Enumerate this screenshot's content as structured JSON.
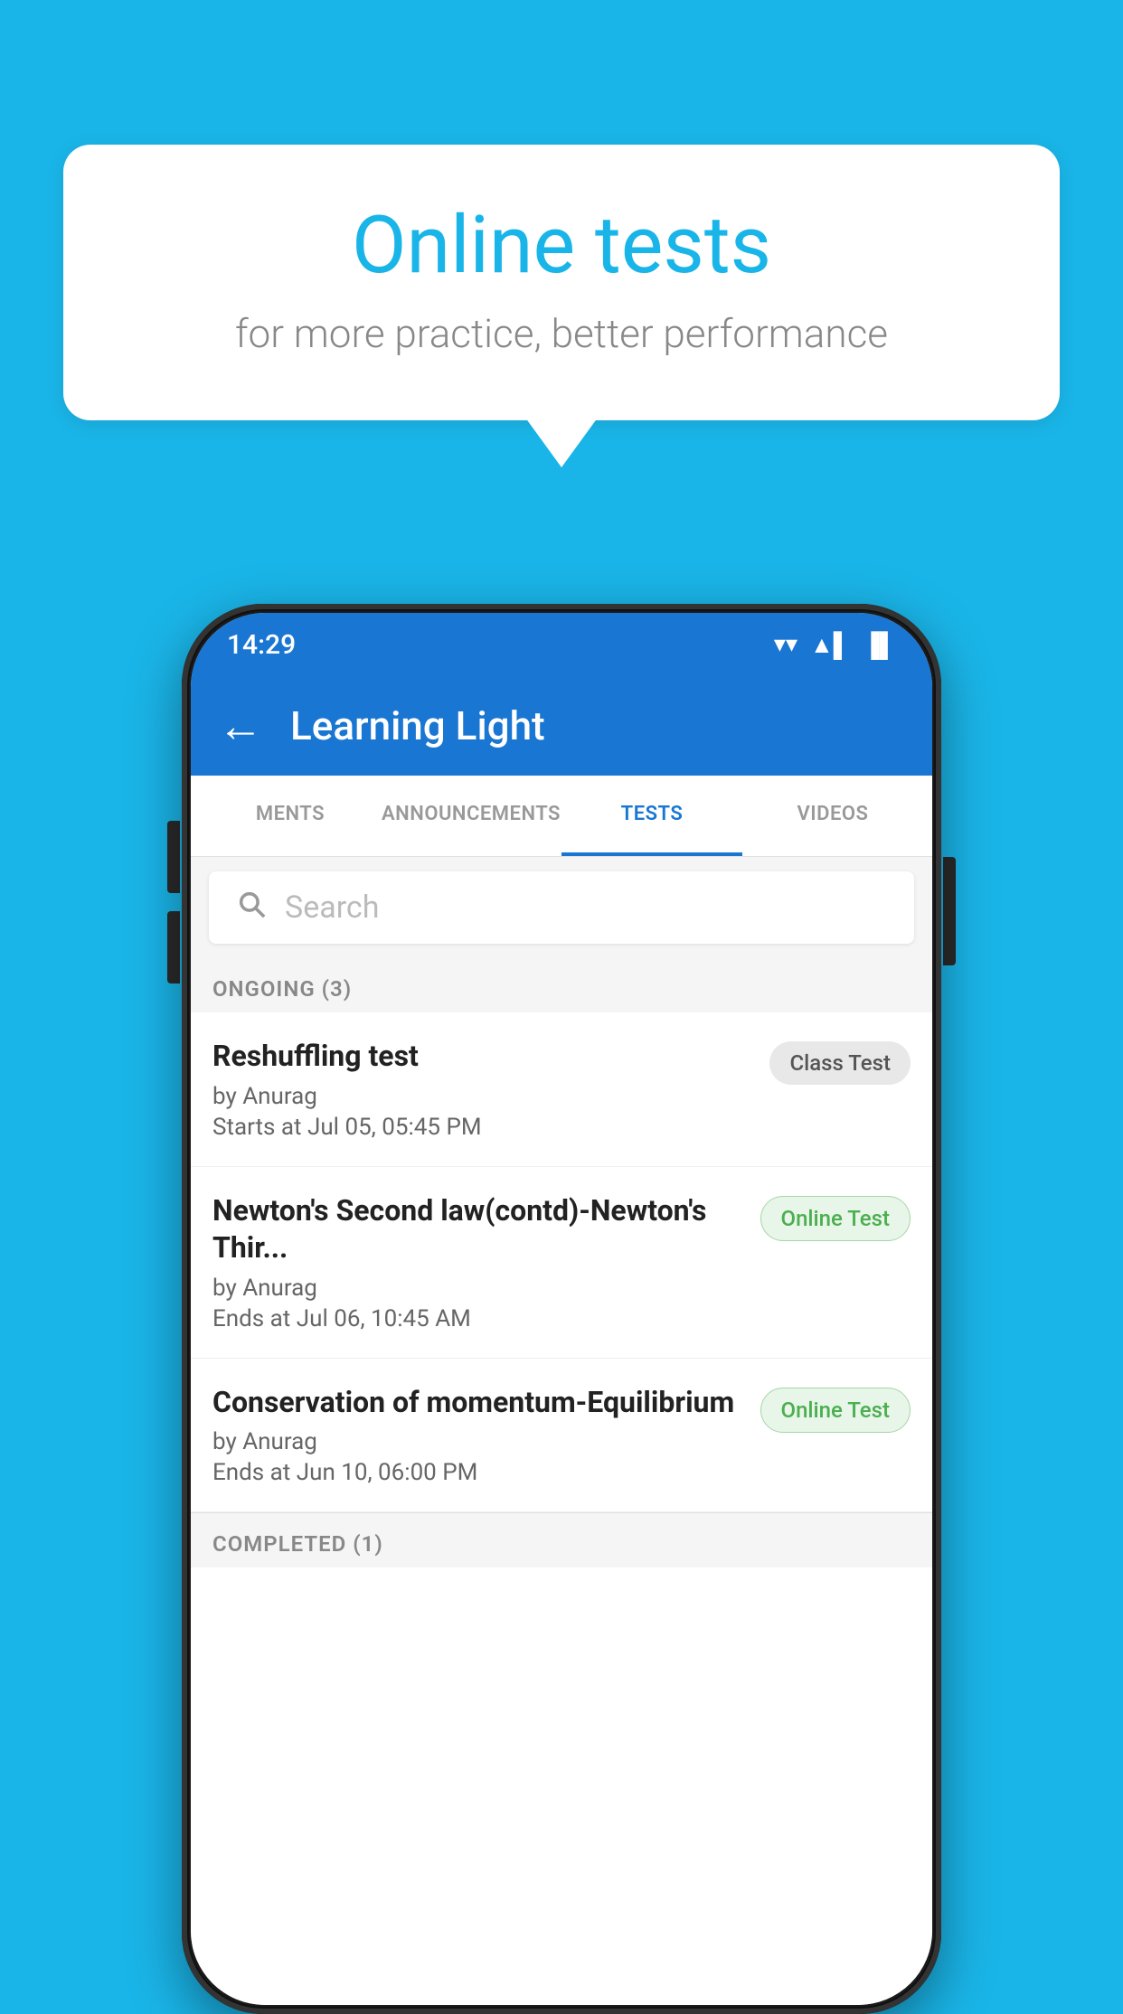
{
  "background_color": "#1ab5e8",
  "speech_bubble": {
    "title": "Online tests",
    "subtitle": "for more practice, better performance"
  },
  "status_bar": {
    "time": "14:29",
    "wifi": "▼",
    "signal": "▲",
    "battery": "▌"
  },
  "app_bar": {
    "back_label": "←",
    "title": "Learning Light"
  },
  "tabs": [
    {
      "label": "MENTS",
      "active": false
    },
    {
      "label": "ANNOUNCEMENTS",
      "active": false
    },
    {
      "label": "TESTS",
      "active": true
    },
    {
      "label": "VIDEOS",
      "active": false
    }
  ],
  "search": {
    "placeholder": "Search"
  },
  "ongoing_section": {
    "label": "ONGOING (3)"
  },
  "tests": [
    {
      "title": "Reshuffling test",
      "author": "by Anurag",
      "time": "Starts at  Jul 05, 05:45 PM",
      "badge": "Class Test",
      "badge_type": "class"
    },
    {
      "title": "Newton's Second law(contd)-Newton's Thir...",
      "author": "by Anurag",
      "time": "Ends at  Jul 06, 10:45 AM",
      "badge": "Online Test",
      "badge_type": "online"
    },
    {
      "title": "Conservation of momentum-Equilibrium",
      "author": "by Anurag",
      "time": "Ends at  Jun 10, 06:00 PM",
      "badge": "Online Test",
      "badge_type": "online"
    }
  ],
  "completed_section": {
    "label": "COMPLETED (1)"
  }
}
